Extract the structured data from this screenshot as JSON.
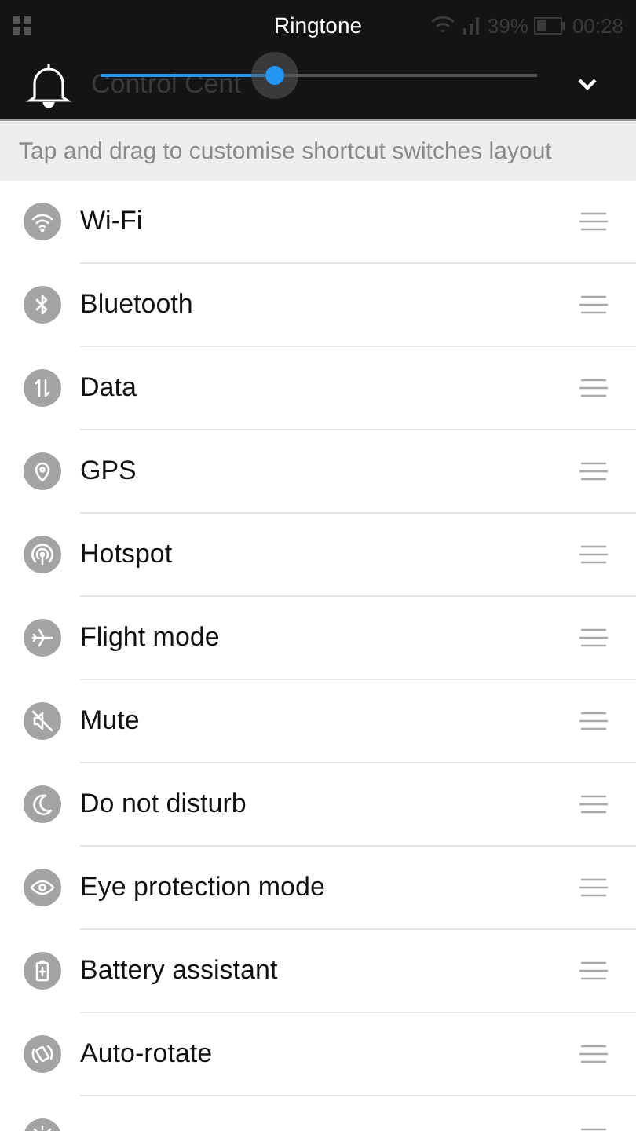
{
  "status_bar": {
    "title": "Ringtone",
    "battery": "39%",
    "time": "00:28"
  },
  "header": {
    "title": "Control Cent",
    "volume": {
      "level": 0.4
    }
  },
  "hint": "Tap and drag to customise shortcut switches layout",
  "switches": [
    {
      "label": "Wi-Fi",
      "kind": "wifi"
    },
    {
      "label": "Bluetooth",
      "kind": "bluetooth"
    },
    {
      "label": "Data",
      "kind": "data"
    },
    {
      "label": "GPS",
      "kind": "gps"
    },
    {
      "label": "Hotspot",
      "kind": "hotspot"
    },
    {
      "label": "Flight mode",
      "kind": "flight"
    },
    {
      "label": "Mute",
      "kind": "mute"
    },
    {
      "label": "Do not disturb",
      "kind": "dnd"
    },
    {
      "label": "Eye protection mode",
      "kind": "eye"
    },
    {
      "label": "Battery assistant",
      "kind": "battery"
    },
    {
      "label": "Auto-rotate",
      "kind": "rotate"
    },
    {
      "kind": "brightness"
    }
  ]
}
